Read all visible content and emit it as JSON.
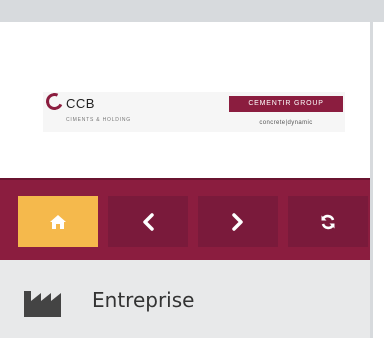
{
  "logo": {
    "company_abbr": "CCB",
    "company_tagline": "CIMENTS & HOLDING",
    "group_name": "CEMENTIR GROUP",
    "group_tagline": "concrete|dynamic",
    "brand_color": "#8b1d3f"
  },
  "nav": {
    "buttons": [
      {
        "name": "home",
        "icon": "home-icon",
        "color": "#f5b94c"
      },
      {
        "name": "back",
        "icon": "chevron-left-icon",
        "color": "#7a1a3b"
      },
      {
        "name": "forward",
        "icon": "chevron-right-icon",
        "color": "#7a1a3b"
      },
      {
        "name": "refresh",
        "icon": "refresh-icon",
        "color": "#7a1a3b"
      }
    ],
    "bar_color": "#8b1d3f"
  },
  "section": {
    "label": "Entreprise",
    "icon": "factory-icon"
  }
}
